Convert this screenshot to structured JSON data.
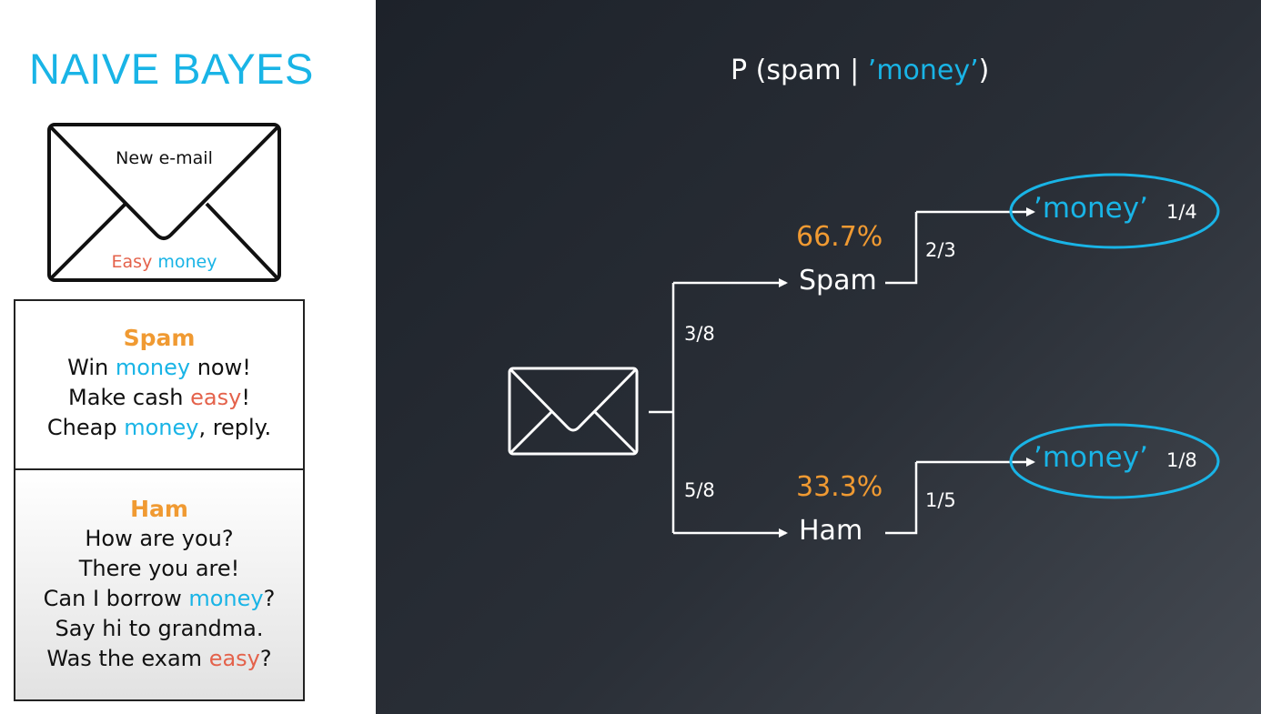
{
  "title": "NAIVE BAYES",
  "new_email": {
    "header": "New e-mail",
    "words": [
      {
        "text": "Easy",
        "color": "#e4624b"
      },
      {
        "text": "money",
        "color": "#19b4e6"
      }
    ]
  },
  "spam_box": {
    "title": "Spam",
    "lines": [
      [
        "Win ",
        {
          "kw": "money",
          "color": "blue"
        },
        " now!"
      ],
      [
        "Make cash ",
        {
          "kw": "easy",
          "color": "red"
        },
        "!"
      ],
      [
        "Cheap ",
        {
          "kw": "money",
          "color": "blue"
        },
        ", reply."
      ]
    ]
  },
  "ham_box": {
    "title": "Ham",
    "lines": [
      [
        "How are you?"
      ],
      [
        "There you are!"
      ],
      [
        "Can I borrow ",
        {
          "kw": "money",
          "color": "blue"
        },
        "?"
      ],
      [
        "Say hi to grandma."
      ],
      [
        "Was the exam ",
        {
          "kw": "easy",
          "color": "red"
        },
        "?"
      ]
    ]
  },
  "equation": {
    "prefix": "P (spam | ",
    "keyword": "’money’",
    "suffix": ")"
  },
  "tree": {
    "prior_spam": "3/8",
    "prior_ham": "5/8",
    "spam": {
      "percent": "66.7%",
      "label": "Spam",
      "branch_fraction": "2/3",
      "leaf_keyword": "’money’",
      "leaf_fraction": "1/4"
    },
    "ham": {
      "percent": "33.3%",
      "label": "Ham",
      "branch_fraction": "1/5",
      "leaf_keyword": "’money’",
      "leaf_fraction": "1/8"
    }
  },
  "colors": {
    "accent_blue": "#19b4e6",
    "accent_orange": "#f09a32",
    "accent_red": "#e4624b"
  }
}
